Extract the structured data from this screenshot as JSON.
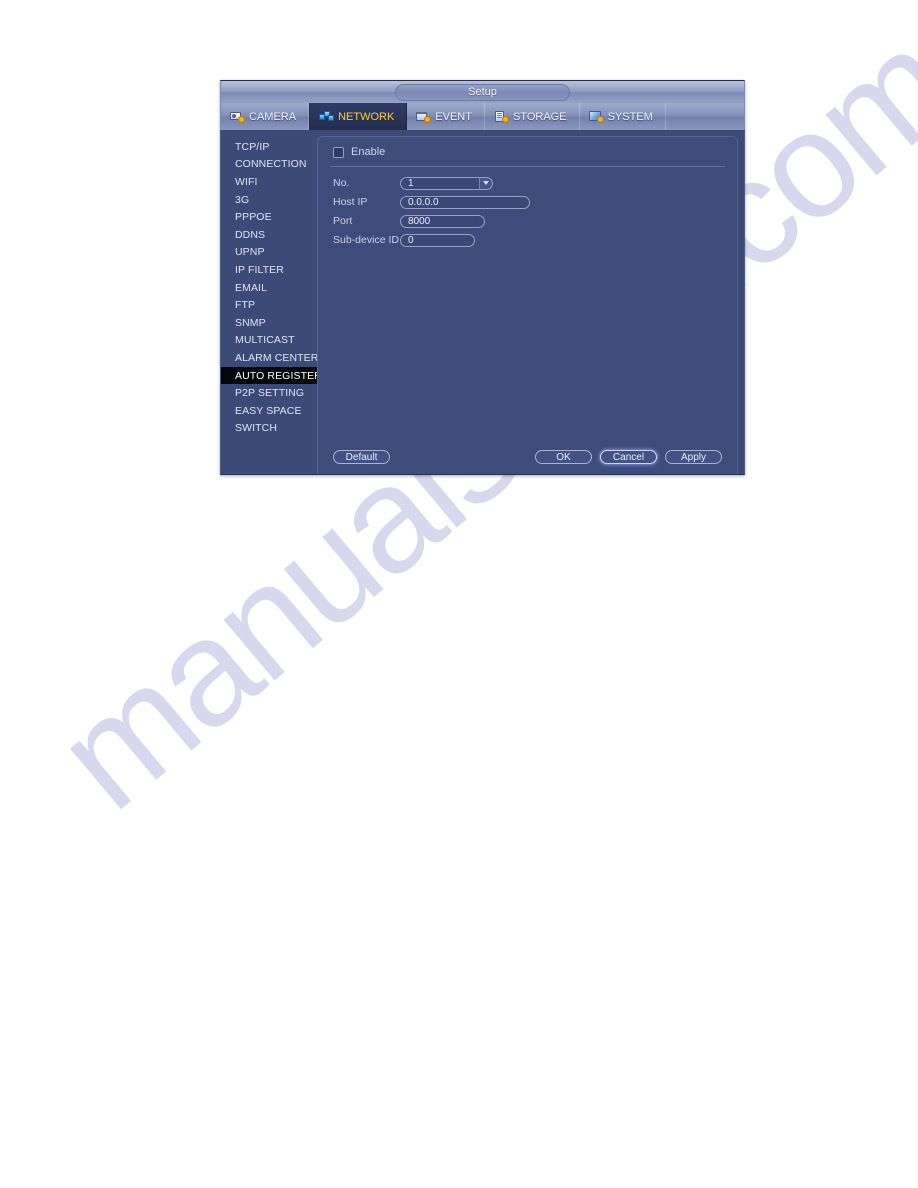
{
  "window": {
    "title": "Setup"
  },
  "tabs": [
    {
      "label": "CAMERA",
      "icon": "camera-icon",
      "active": false
    },
    {
      "label": "NETWORK",
      "icon": "network-icon",
      "active": true
    },
    {
      "label": "EVENT",
      "icon": "event-icon",
      "active": false
    },
    {
      "label": "STORAGE",
      "icon": "storage-icon",
      "active": false
    },
    {
      "label": "SYSTEM",
      "icon": "system-icon",
      "active": false
    }
  ],
  "sidebar": {
    "items": [
      {
        "label": "TCP/IP",
        "selected": false
      },
      {
        "label": "CONNECTION",
        "selected": false
      },
      {
        "label": "WIFI",
        "selected": false
      },
      {
        "label": "3G",
        "selected": false
      },
      {
        "label": "PPPOE",
        "selected": false
      },
      {
        "label": "DDNS",
        "selected": false
      },
      {
        "label": "UPNP",
        "selected": false
      },
      {
        "label": "IP FILTER",
        "selected": false
      },
      {
        "label": "EMAIL",
        "selected": false
      },
      {
        "label": "FTP",
        "selected": false
      },
      {
        "label": "SNMP",
        "selected": false
      },
      {
        "label": "MULTICAST",
        "selected": false
      },
      {
        "label": "ALARM CENTER",
        "selected": false
      },
      {
        "label": "AUTO REGISTER",
        "selected": true
      },
      {
        "label": "P2P SETTING",
        "selected": false
      },
      {
        "label": "EASY SPACE",
        "selected": false
      },
      {
        "label": "SWITCH",
        "selected": false
      }
    ]
  },
  "form": {
    "enable": {
      "label": "Enable",
      "checked": false
    },
    "fields": [
      {
        "label": "No.",
        "value": "1",
        "type": "dropdown"
      },
      {
        "label": "Host IP",
        "value": "0.0.0.0",
        "type": "text"
      },
      {
        "label": "Port",
        "value": "8000",
        "type": "text"
      },
      {
        "label": "Sub-device ID",
        "value": "0",
        "type": "text"
      }
    ]
  },
  "buttons": {
    "default_label": "Default",
    "ok_label": "OK",
    "cancel_label": "Cancel",
    "apply_label": "Apply"
  },
  "watermark": {
    "text": "manualshive.com"
  },
  "colors": {
    "window_bg": "#3b4a77",
    "panel_bg": "#3d4c7a",
    "active_tab_text": "#ffcc33",
    "selected_item_bg": "#05060a",
    "field_border": "#97a3c6"
  }
}
